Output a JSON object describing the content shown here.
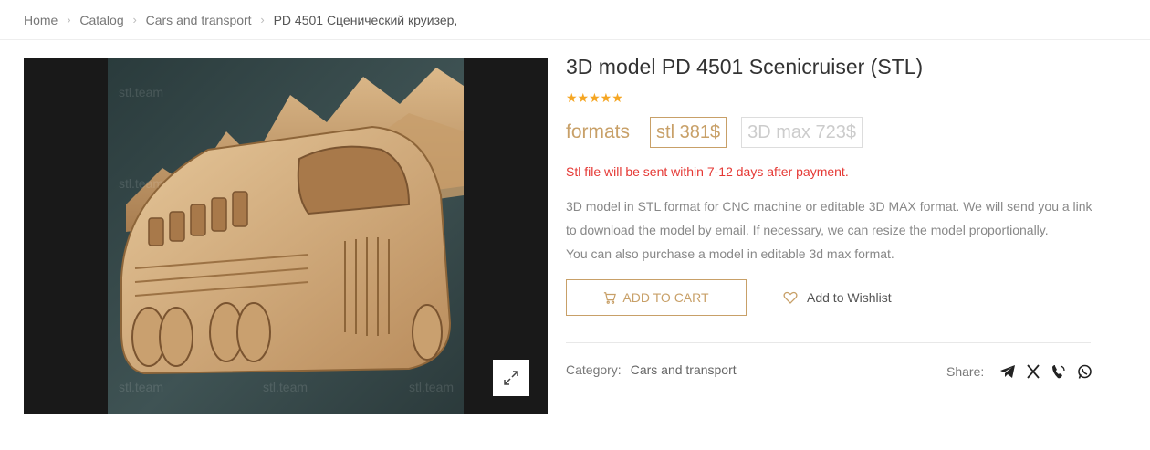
{
  "breadcrumb": {
    "items": [
      "Home",
      "Catalog",
      "Cars and transport",
      "PD 4501 Сценический круизер,"
    ],
    "separator_icon": "chevron-right-icon"
  },
  "product": {
    "title": "3D model PD 4501 Scenicruiser (STL)",
    "rating": {
      "value": 5,
      "max": 5,
      "glyphs": "★★★★★"
    },
    "formats_label": "formats",
    "formats": [
      {
        "label": "stl 381$",
        "selected": true
      },
      {
        "label": "3D max 723$",
        "selected": false
      }
    ],
    "notice": "Stl file will be sent within 7-12 days after payment.",
    "description": [
      "3D model in STL format for CNC machine or editable 3D MAX format. We will send you a link",
      "to download the model by email. If necessary, we can resize the model proportionally.",
      "You can also purchase a model in editable 3d max format."
    ],
    "add_to_cart_label": "ADD TO CART",
    "wishlist_label": "Add to Wishlist",
    "category_label": "Category:",
    "category_value": "Cars and transport",
    "share_label": "Share:",
    "share_icons": [
      "telegram-icon",
      "x-twitter-icon",
      "viber-icon",
      "whatsapp-icon"
    ]
  },
  "gallery": {
    "watermark": "stl.team",
    "zoom_icon": "expand-icon"
  },
  "colors": {
    "accent": "#c8a068",
    "notice": "#e53935",
    "stars": "#f5a623"
  }
}
